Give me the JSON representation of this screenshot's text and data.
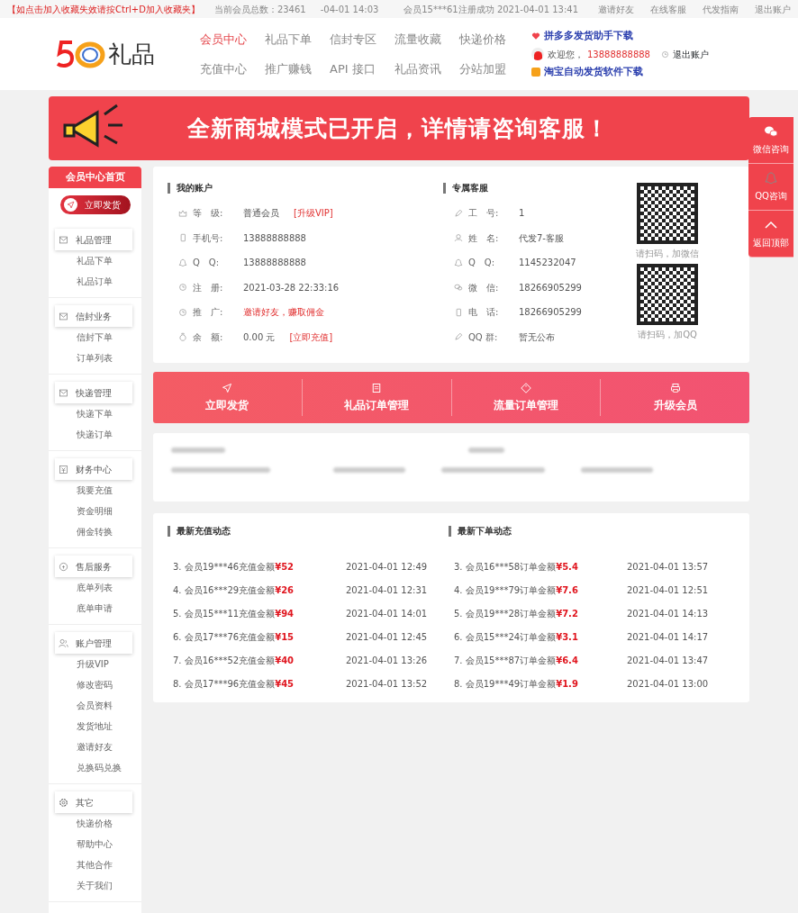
{
  "topbar": {
    "notice": "【如点击加入收藏失效请按Ctrl+D加入收藏夹】",
    "member_count": "当前会员总数：23461",
    "time": "-04-01 14:03",
    "signup": "会员15***61注册成功  2021-04-01 13:41",
    "links": [
      "邀请好友",
      "在线客服",
      "代发指南",
      "退出账户"
    ]
  },
  "header": {
    "logo_text": "礼品",
    "nav": [
      {
        "label": "会员中心",
        "selected": true
      },
      {
        "label": "礼品下单",
        "selected": false
      },
      {
        "label": "信封专区",
        "selected": false
      },
      {
        "label": "流量收藏",
        "selected": false
      },
      {
        "label": "快递价格",
        "selected": false
      },
      {
        "label": "充值中心",
        "selected": false
      },
      {
        "label": "推广赚钱",
        "selected": false
      },
      {
        "label": "API 接口",
        "selected": false
      },
      {
        "label": "礼品资讯",
        "selected": false
      },
      {
        "label": "分站加盟",
        "selected": false
      }
    ],
    "download_1": "拼多多发货助手下载",
    "welcome": "欢迎您，",
    "phone": "13888888888",
    "logout": "退出账户",
    "download_2": "淘宝自动发货软件下载"
  },
  "banner": {
    "text": "全新商城模式已开启，详情请咨询客服！"
  },
  "sidebar": {
    "home": "会员中心首页",
    "ship_button": "立即发货",
    "groups": [
      {
        "title": "礼品管理",
        "items": [
          "礼品下单",
          "礼品订单"
        ]
      },
      {
        "title": "信封业务",
        "items": [
          "信封下单",
          "订单列表"
        ]
      },
      {
        "title": "快递管理",
        "items": [
          "快递下单",
          "快递订单"
        ]
      },
      {
        "title": "财务中心",
        "items": [
          "我要充值",
          "资金明细",
          "佣金转换"
        ]
      },
      {
        "title": "售后服务",
        "items": [
          "底单列表",
          "底单申请"
        ]
      },
      {
        "title": "账户管理",
        "items": [
          "升级VIP",
          "修改密码",
          "会员资料",
          "发货地址",
          "邀请好友",
          "兑换码兑换"
        ]
      },
      {
        "title": "其它",
        "items": [
          "快递价格",
          "帮助中心",
          "其他合作",
          "关于我们"
        ]
      }
    ]
  },
  "account": {
    "title": "我的账户",
    "rows": [
      {
        "label": "等　级:",
        "value": "普通会员",
        "link": "[升级VIP]",
        "kind": "plain"
      },
      {
        "label": "手机号:",
        "value": "13888888888",
        "kind": "plain"
      },
      {
        "label": "Q　Q:",
        "value": "13888888888",
        "kind": "plain"
      },
      {
        "label": "注　册:",
        "value": "2021-03-28 22:33:16",
        "kind": "plain"
      },
      {
        "label": "推　广:",
        "value": "邀请好友，赚取佣金",
        "kind": "alert"
      },
      {
        "label": "余　额:",
        "value": "0.00 元",
        "link": "[立即充值]",
        "kind": "plain"
      }
    ]
  },
  "service": {
    "title": "专属客服",
    "rows": [
      {
        "label": "工　号:",
        "value": "1"
      },
      {
        "label": "姓　名:",
        "value": "代发7-客服"
      },
      {
        "label": "Q　Q:",
        "value": "1145232047"
      },
      {
        "label": "微　信:",
        "value": "18266905299"
      },
      {
        "label": "电　话:",
        "value": "18266905299"
      },
      {
        "label": "QQ 群:",
        "value": "暂无公布"
      }
    ],
    "qr_captions": [
      "请扫码，加微信",
      "请扫码，加QQ"
    ]
  },
  "actions": [
    "立即发货",
    "礼品订单管理",
    "流量订单管理",
    "升级会员"
  ],
  "feeds": [
    {
      "title": "最新充值动态",
      "rows": [
        {
          "text": "3. 会员19***46充值金额",
          "amount": "¥52",
          "time": "2021-04-01 12:49"
        },
        {
          "text": "4. 会员16***29充值金额",
          "amount": "¥26",
          "time": "2021-04-01 12:31"
        },
        {
          "text": "5. 会员15***11充值金额",
          "amount": "¥94",
          "time": "2021-04-01 14:01"
        },
        {
          "text": "6. 会员17***76充值金额",
          "amount": "¥15",
          "time": "2021-04-01 12:45"
        },
        {
          "text": "7. 会员16***52充值金额",
          "amount": "¥40",
          "time": "2021-04-01 13:26"
        },
        {
          "text": "8. 会员17***96充值金额",
          "amount": "¥45",
          "time": "2021-04-01 13:52"
        }
      ]
    },
    {
      "title": "最新下单动态",
      "rows": [
        {
          "text": "3. 会员16***58订单金额",
          "amount": "¥5.4",
          "time": "2021-04-01 13:57"
        },
        {
          "text": "4. 会员19***79订单金额",
          "amount": "¥7.6",
          "time": "2021-04-01 12:51"
        },
        {
          "text": "5. 会员19***28订单金额",
          "amount": "¥7.2",
          "time": "2021-04-01 14:13"
        },
        {
          "text": "6. 会员15***24订单金额",
          "amount": "¥3.1",
          "time": "2021-04-01 14:17"
        },
        {
          "text": "7. 会员15***87订单金额",
          "amount": "¥6.4",
          "time": "2021-04-01 13:47"
        },
        {
          "text": "8. 会员19***49订单金额",
          "amount": "¥1.9",
          "time": "2021-04-01 13:00"
        }
      ]
    }
  ],
  "float_buttons": [
    "微信咨询",
    "QQ咨询",
    "返回顶部"
  ]
}
